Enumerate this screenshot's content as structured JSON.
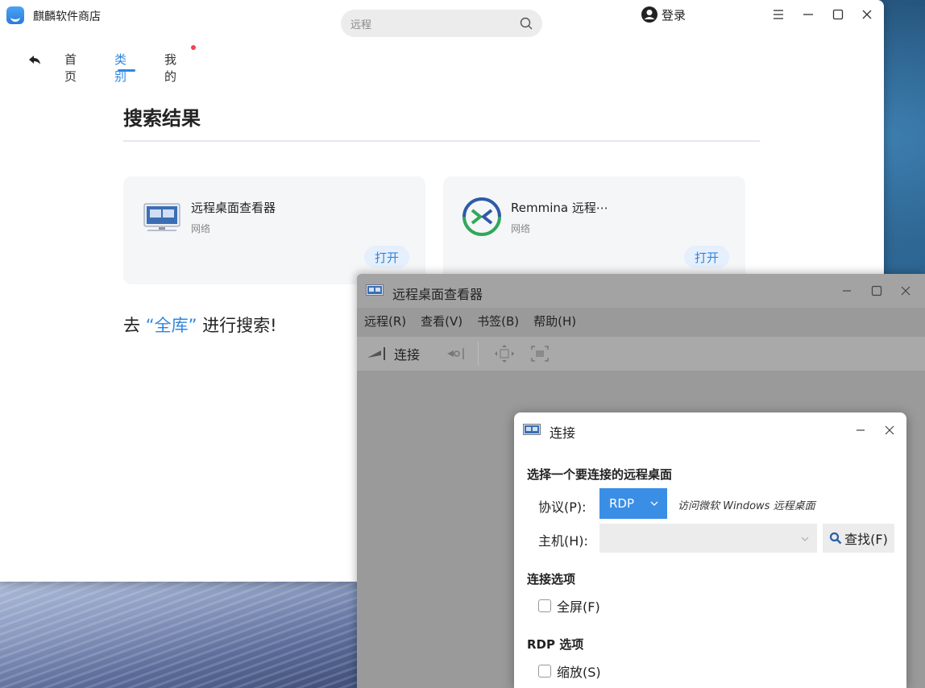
{
  "store": {
    "app_title": "麒麟软件商店",
    "search_value": "远程",
    "login": "登录",
    "nav": {
      "home": "首页",
      "category": "类别",
      "mine": "我的"
    },
    "results_title": "搜索结果",
    "cards": [
      {
        "name": "远程桌面查看器",
        "category": "网络",
        "open": "打开"
      },
      {
        "name": "Remmina 远程⋯",
        "category": "网络",
        "open": "打开"
      }
    ],
    "search_all_prefix": "去",
    "search_all_link": "“全库”",
    "search_all_suffix": "进行搜索!"
  },
  "viewer": {
    "title": "远程桌面查看器",
    "menu": [
      "远程(R)",
      "查看(V)",
      "书签(B)",
      "帮助(H)"
    ],
    "toolbar_connect": "连接"
  },
  "dialog": {
    "title": "连接",
    "section_choose": "选择一个要连接的远程桌面",
    "protocol_label": "协议(P):",
    "protocol_value": "RDP",
    "protocol_desc": "访问微软 Windows 远程桌面",
    "host_label": "主机(H):",
    "find_button": "查找(F)",
    "section_conn_options": "连接选项",
    "fullscreen": "全屏(F)",
    "section_rdp_options": "RDP 选项",
    "scale": "缩放(S)"
  },
  "colors": {
    "accent": "#2f86e0",
    "rdp_select": "#3a8ee6",
    "notify_dot": "#f0454c"
  }
}
